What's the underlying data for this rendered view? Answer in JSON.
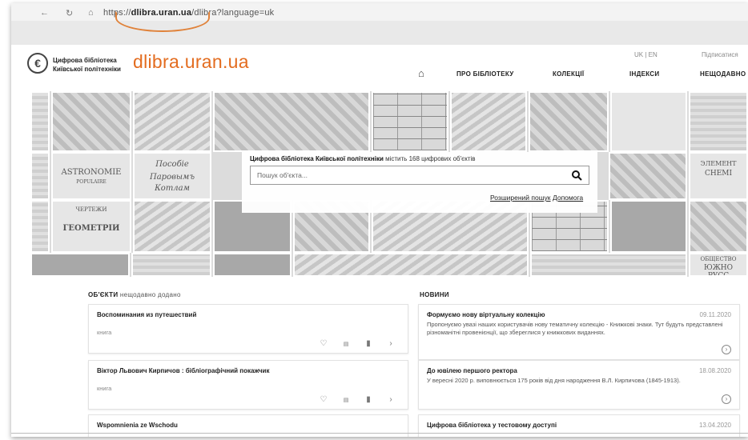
{
  "browser": {
    "url_prefix": "https://",
    "url_host": "dlibra.uran.ua",
    "url_rest": "/dlibra?language=uk"
  },
  "annotation": {
    "domain_label": "dlibra.uran.ua",
    "color": "#e36c1f"
  },
  "header": {
    "logo_line1": "Цифрова бібліотека",
    "logo_line2": "Київської політехніки",
    "lang_uk": "UK",
    "lang_sep": "|",
    "lang_en": "EN",
    "subscribe": "Підписатися",
    "nav": [
      "ПРО БІБЛІОТЕКУ",
      "КОЛЕКЦІЇ",
      "ІНДЕКСИ",
      "НЕЩОДАВНО"
    ]
  },
  "hero": {
    "caption_bold": "Цифрова бібліотека Київської політехніки",
    "caption_rest": " містить 168 цифрових об'єктів",
    "search_placeholder": "Пошук об'єкта...",
    "advanced_search": "Розширений пошук",
    "help": "Допомога",
    "book_titles": [
      "ASTRONOMIE",
      "POPULAIRE",
      "Пособіе",
      "Паровымъ",
      "Котлам",
      "ГЕОМЕТРІИ",
      "ЧЕРТЕЖИ",
      "ЭЛЕМЕНТ",
      "СНЕМІ",
      "ОБЩЕСТВО",
      "ЮЖНО РУСС"
    ]
  },
  "objects": {
    "title": "ОБ'ЄКТИ",
    "subtitle": "нещодавно додано",
    "items": [
      {
        "title": "Воспоминания из путешествий",
        "type": "книга"
      },
      {
        "title": "Віктор Львович Кирпичов : бібліографічний покажчик",
        "type": "книга"
      },
      {
        "title": "Wspomnienia ze Wschodu",
        "type": ""
      }
    ]
  },
  "news": {
    "title": "НОВИНИ",
    "items": [
      {
        "title": "Формуємо нову віртуальну колекцію",
        "date": "09.11.2020",
        "body": "Пропонуємо увазі наших користувачів нову тематичну колекцію - Книжкові знаки. Тут будуть представлені різноманітні провенієнції, що збереглися у книжкових виданнях."
      },
      {
        "title": "До ювілею першого ректора",
        "date": "18.08.2020",
        "body": "У вересні 2020 р. виповнюється 175 років від дня народження В.Л. Кирпичова (1845-1913)."
      },
      {
        "title": "Цифрова бібліотека у тестовому доступі",
        "date": "13.04.2020",
        "body": ""
      }
    ]
  },
  "icons": {
    "favorite": "heart-icon",
    "bibtex": "bib-icon",
    "details": "document-icon",
    "more": "arrow-right-circle-icon",
    "home": "home-icon",
    "search": "search-icon"
  }
}
